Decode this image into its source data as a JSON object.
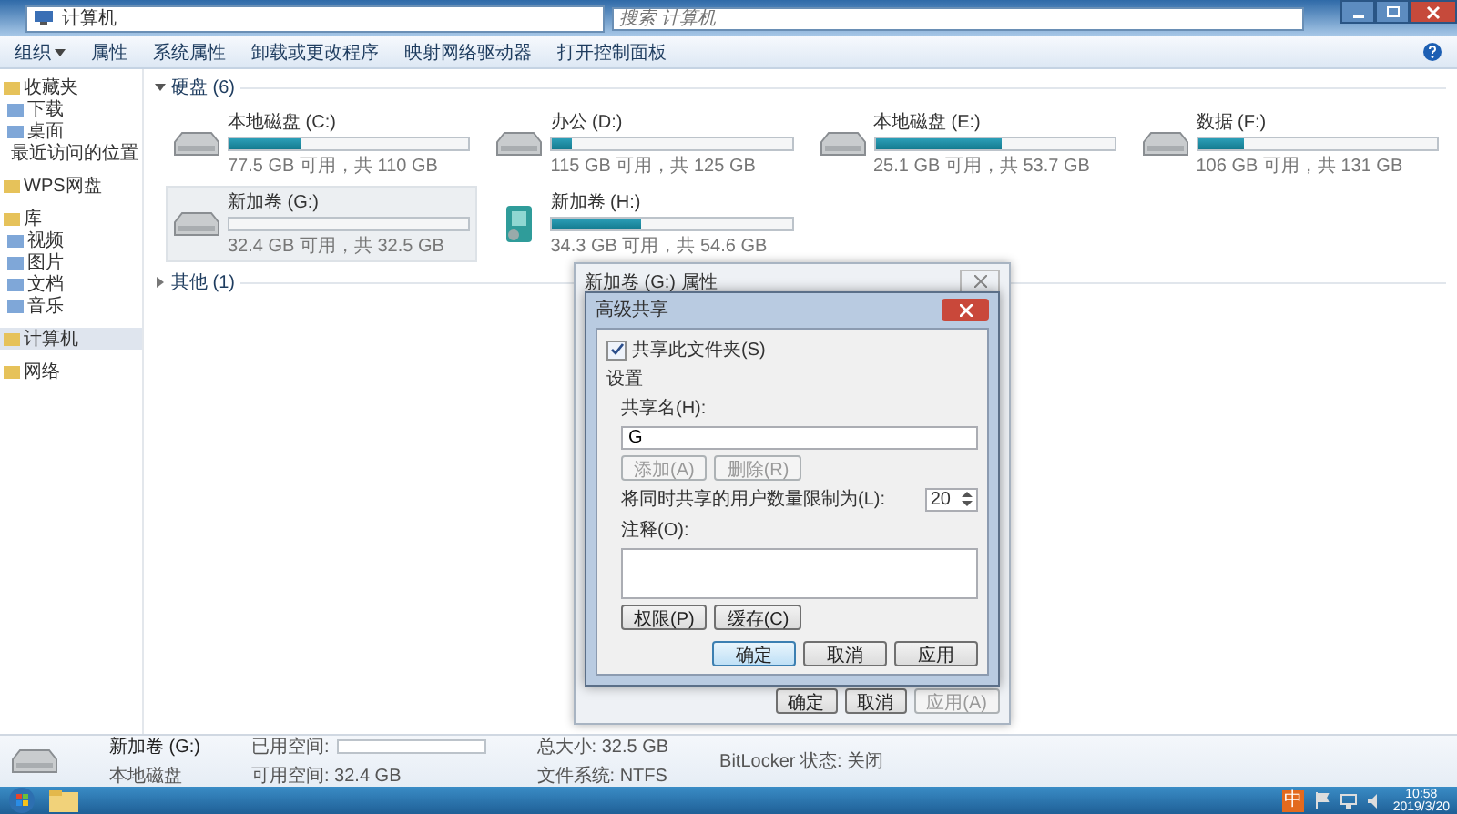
{
  "window": {
    "address": [
      "计算机"
    ],
    "search_placeholder": "搜索 计算机"
  },
  "toolbar": [
    {
      "label": "组织",
      "dropdown": true
    },
    {
      "label": "属性",
      "dropdown": false
    },
    {
      "label": "系统属性",
      "dropdown": false
    },
    {
      "label": "卸载或更改程序",
      "dropdown": false
    },
    {
      "label": "映射网络驱动器",
      "dropdown": false
    },
    {
      "label": "打开控制面板",
      "dropdown": false
    }
  ],
  "sidebar": [
    {
      "label": "收藏夹",
      "selected": false,
      "children": [
        {
          "label": "下载",
          "selected": false
        },
        {
          "label": "桌面",
          "selected": false
        },
        {
          "label": "最近访问的位置",
          "selected": false
        }
      ]
    },
    {
      "label": "WPS网盘",
      "selected": false
    },
    {
      "label": "库",
      "selected": false,
      "children": [
        {
          "label": "视频",
          "selected": false
        },
        {
          "label": "图片",
          "selected": false
        },
        {
          "label": "文档",
          "selected": false
        },
        {
          "label": "音乐",
          "selected": false
        }
      ]
    },
    {
      "label": "计算机",
      "selected": true
    },
    {
      "label": "网络",
      "selected": false
    }
  ],
  "sections": [
    {
      "title": "硬盘 (6)",
      "expanded": true,
      "drives": [
        {
          "name": "本地磁盘 (C:)",
          "space": "77.5 GB 可用，共 110 GB",
          "level": 0.3,
          "selected": false,
          "kind": "disk"
        },
        {
          "name": "办公 (D:)",
          "space": "115 GB 可用，共 125 GB",
          "level": 0.08,
          "selected": false,
          "kind": "disk"
        },
        {
          "name": "本地磁盘 (E:)",
          "space": "25.1 GB 可用，共 53.7 GB",
          "level": 0.53,
          "selected": false,
          "kind": "disk"
        },
        {
          "name": "数据 (F:)",
          "space": "106 GB 可用，共 131 GB",
          "level": 0.19,
          "selected": false,
          "kind": "disk"
        },
        {
          "name": "新加卷 (G:)",
          "space": "32.4 GB 可用，共 32.5 GB",
          "level": 0.003,
          "selected": true,
          "kind": "disk"
        },
        {
          "name": "新加卷 (H:)",
          "space": "34.3 GB 可用，共 54.6 GB",
          "level": 0.37,
          "selected": false,
          "kind": "removable"
        }
      ]
    },
    {
      "title": "其他 (1)",
      "expanded": false
    }
  ],
  "dialog": {
    "title": "新加卷 (G:) 属性",
    "buttons": [
      {
        "label": "确定",
        "disabled": false
      },
      {
        "label": "取消",
        "disabled": false
      },
      {
        "label": "应用(A)",
        "disabled": true
      }
    ]
  },
  "share_dialog": {
    "title": "高级共享",
    "share": {
      "label": "共享此文件夹(S)",
      "checked": true
    },
    "settings_label": "设置",
    "name_label": "共享名(H):",
    "name_value": "G",
    "name_buttons": [
      {
        "label": "添加(A)",
        "disabled": true
      },
      {
        "label": "删除(R)",
        "disabled": true
      }
    ],
    "limit_label": "将同时共享的用户数量限制为(L):",
    "limit_value": "20",
    "comment_label": "注释(O):",
    "option_buttons": [
      {
        "label": "权限(P)",
        "default": false
      },
      {
        "label": "缓存(C)",
        "default": false
      }
    ],
    "buttons": [
      {
        "label": "确定",
        "default": true
      },
      {
        "label": "取消",
        "default": false
      },
      {
        "label": "应用",
        "default": false
      }
    ]
  },
  "details": {
    "name": "新加卷 (G:)",
    "type": "本地磁盘",
    "used_label": "已用空间:",
    "level": 0.003,
    "free": "可用空间: 32.4 GB",
    "total": "总大小: 32.5 GB",
    "filesystem": "文件系统: NTFS",
    "bitlocker": "BitLocker 状态: 关闭"
  },
  "taskbar": {
    "ime": "中",
    "time": "10:58",
    "date": "2019/3/20"
  }
}
